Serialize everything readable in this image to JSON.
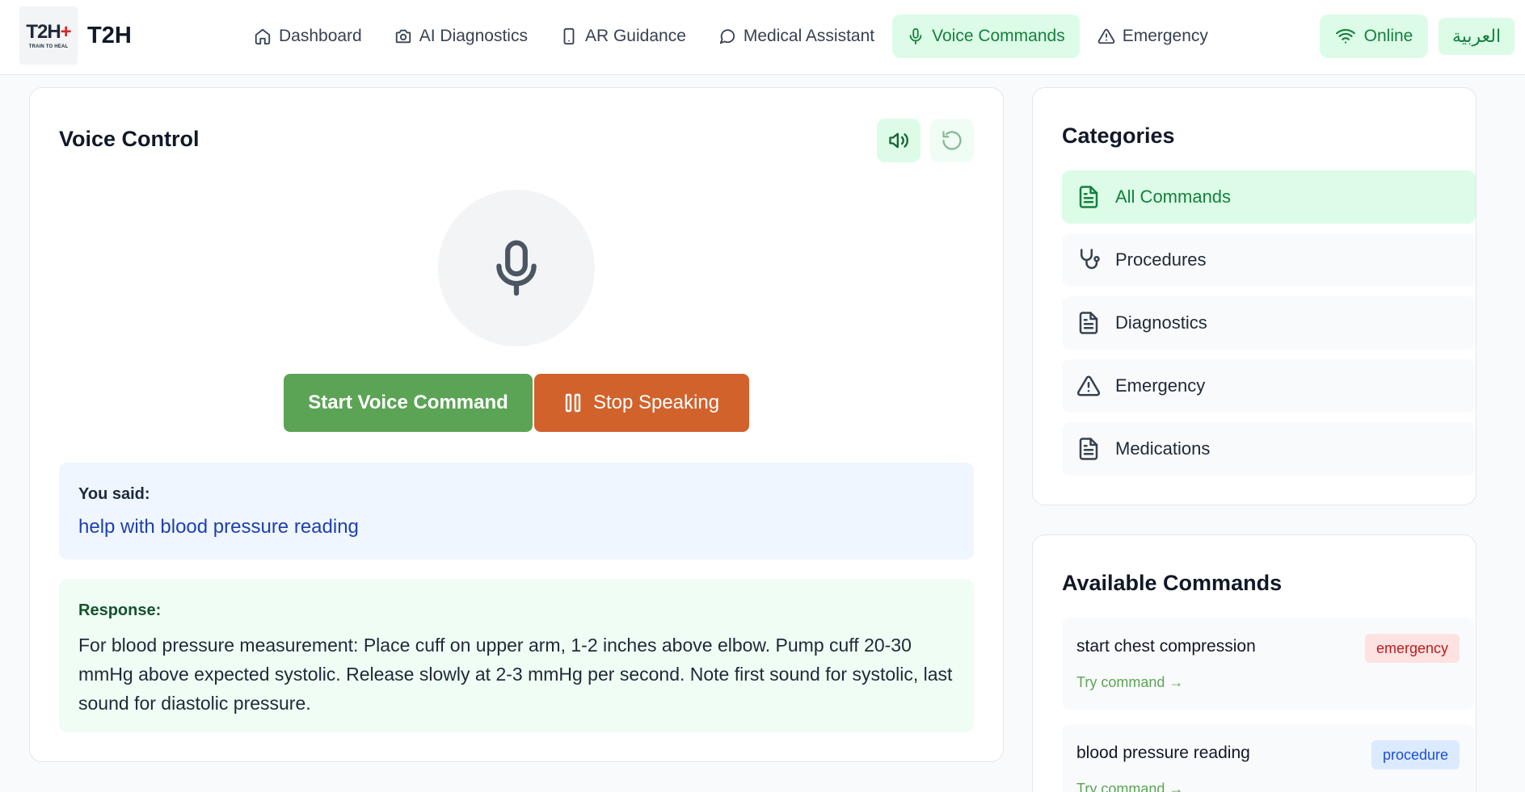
{
  "app": {
    "logo_mark": "T2H",
    "logo_tagline": "TRAIN TO HEAL",
    "brand": "T2H"
  },
  "nav": {
    "items": [
      {
        "label": "Dashboard",
        "icon": "home-icon"
      },
      {
        "label": "AI Diagnostics",
        "icon": "camera-icon"
      },
      {
        "label": "AR Guidance",
        "icon": "tablet-icon"
      },
      {
        "label": "Medical Assistant",
        "icon": "chat-bubble-icon"
      },
      {
        "label": "Voice Commands",
        "icon": "mic-icon",
        "active": true
      },
      {
        "label": "Emergency",
        "icon": "warning-icon"
      }
    ]
  },
  "status": {
    "online_label": "Online",
    "language_label": "العربية"
  },
  "voice_control": {
    "title": "Voice Control",
    "start_label": "Start Voice Command",
    "stop_label": "Stop Speaking",
    "you_said_label": "You said:",
    "you_said_text": "help with blood pressure reading",
    "response_label": "Response:",
    "response_text": "For blood pressure measurement: Place cuff on upper arm, 1-2 inches above elbow. Pump cuff 20-30 mmHg above expected systolic. Release slowly at 2-3 mmHg per second. Note first sound for systolic, last sound for diastolic pressure."
  },
  "categories": {
    "title": "Categories",
    "items": [
      {
        "label": "All Commands",
        "icon": "document-icon",
        "active": true
      },
      {
        "label": "Procedures",
        "icon": "stethoscope-icon"
      },
      {
        "label": "Diagnostics",
        "icon": "document-icon"
      },
      {
        "label": "Emergency",
        "icon": "warning-icon"
      },
      {
        "label": "Medications",
        "icon": "document-icon"
      }
    ]
  },
  "commands": {
    "title": "Available Commands",
    "items": [
      {
        "name": "start chest compression",
        "badge": "emergency",
        "try_label": "Try command →"
      },
      {
        "name": "blood pressure reading",
        "badge": "procedure",
        "try_label": "Try command →"
      }
    ]
  },
  "colors": {
    "accent_green": "#5ba455",
    "active_bg": "#dcfce7",
    "stop_orange": "#d2622c",
    "emergency_badge": "#fee2e2",
    "procedure_badge": "#dbeafe"
  }
}
